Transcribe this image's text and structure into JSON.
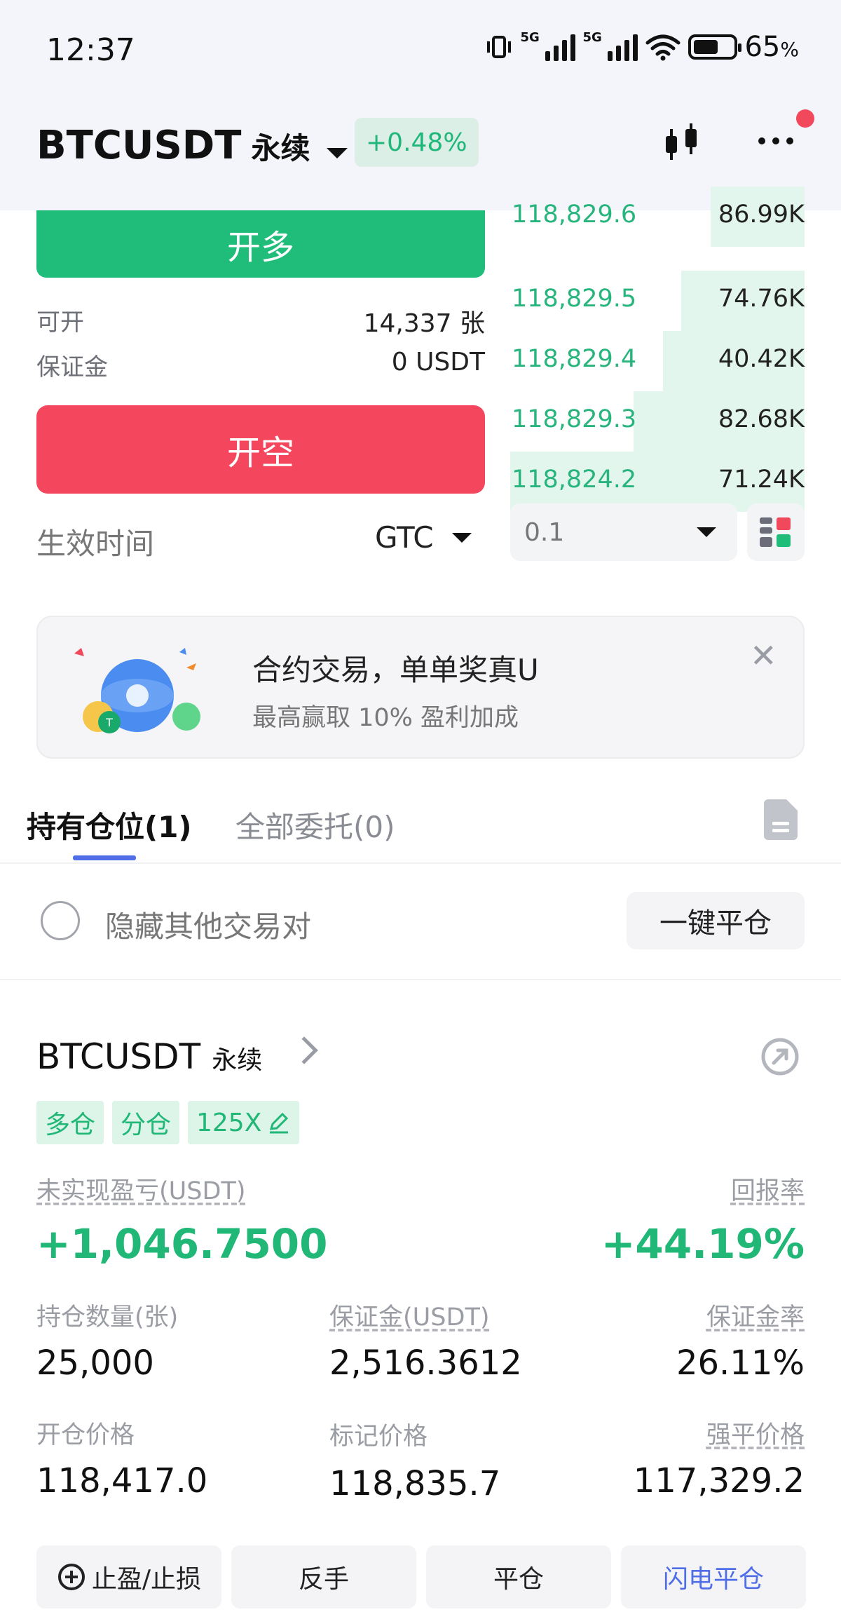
{
  "status_bar": {
    "time": "12:37",
    "network_1": "5G",
    "network_2": "5G",
    "battery_percent": "65",
    "battery_unit": "%"
  },
  "header": {
    "pair": "BTCUSDT",
    "contract_type": "永续",
    "change": "+0.48%",
    "change_color": "#1fb77a"
  },
  "trade_form": {
    "long_label": "开多",
    "short_label": "开空",
    "available_label": "可开",
    "available_value": "14,337 张",
    "margin_label": "保证金",
    "margin_value": "0 USDT",
    "effective_time_label": "生效时间",
    "effective_time_value": "GTC"
  },
  "order_book": {
    "rows": [
      {
        "price": "118,829.6",
        "qty": "86.99K",
        "depth": 0.32
      },
      {
        "price": "118,829.5",
        "qty": "74.76K",
        "depth": 0.42
      },
      {
        "price": "118,829.4",
        "qty": "40.42K",
        "depth": 0.48
      },
      {
        "price": "118,829.3",
        "qty": "82.68K",
        "depth": 0.58
      },
      {
        "price": "118,824.2",
        "qty": "71.24K",
        "depth": 1.0
      }
    ],
    "depth_precision": "0.1"
  },
  "banner": {
    "title": "合约交易，单单奖真U",
    "subtitle": "最高赢取 10% 盈利加成"
  },
  "tabs": {
    "positions": "持有仓位(1)",
    "orders": "全部委托(0)"
  },
  "filter": {
    "hide_label": "隐藏其他交易对",
    "close_all": "一键平仓"
  },
  "position": {
    "pair": "BTCUSDT",
    "type": "永续",
    "tags": [
      "多仓",
      "分仓",
      "125X"
    ],
    "pnl_label": "未实现盈亏(USDT)",
    "pnl_value": "+1,046.7500",
    "roe_label": "回报率",
    "roe_value": "+44.19%",
    "qty_label": "持仓数量(张)",
    "qty_value": "25,000",
    "margin_label": "保证金(USDT)",
    "margin_value": "2,516.3612",
    "margin_rate_label": "保证金率",
    "margin_rate_value": "26.11%",
    "entry_label": "开仓价格",
    "entry_value": "118,417.0",
    "mark_label": "标记价格",
    "mark_value": "118,835.7",
    "liq_label": "强平价格",
    "liq_value": "117,329.2"
  },
  "actions": {
    "tp_sl": "止盈/止损",
    "reverse": "反手",
    "close": "平仓",
    "flash_close": "闪电平仓"
  }
}
